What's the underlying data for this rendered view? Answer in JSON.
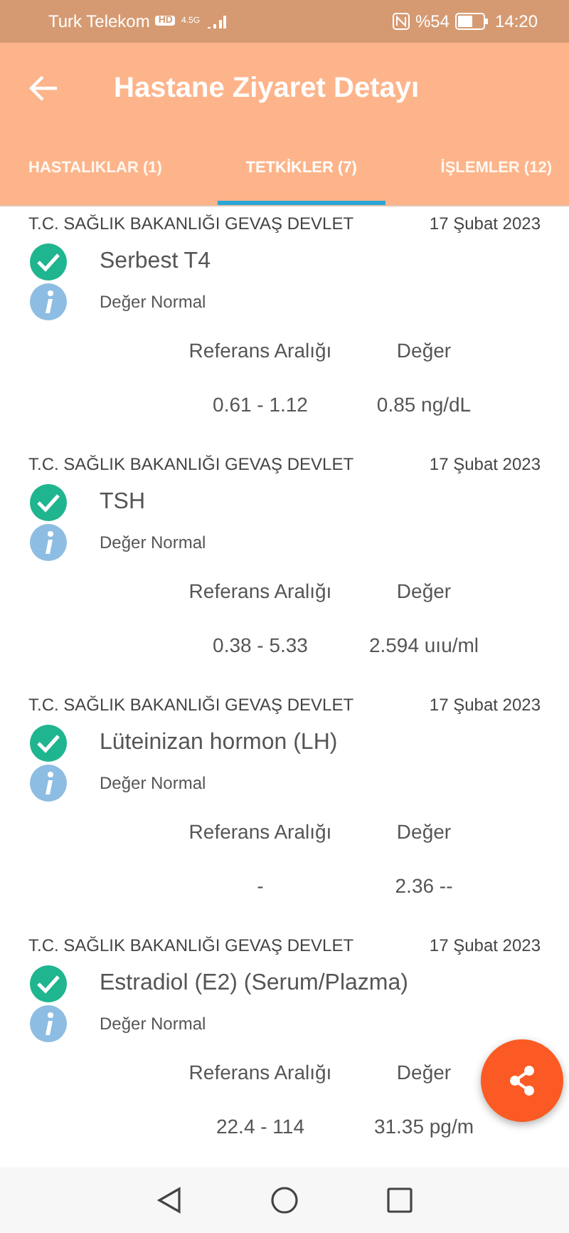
{
  "status_bar": {
    "carrier": "Turk Telekom",
    "hd": "HD",
    "network": "4.5G",
    "battery": "%54",
    "time": "14:20"
  },
  "header": {
    "title": "Hastane Ziyaret Detayı"
  },
  "tabs": [
    {
      "label": "HASTALIKLAR (1)",
      "selected": false
    },
    {
      "label": "TETKİKLER (7)",
      "selected": true
    },
    {
      "label": "İŞLEMLER (12)",
      "selected": false
    }
  ],
  "tests": [
    {
      "institution": "T.C. SAĞLIK BAKANLIĞI GEVAŞ DEVLET",
      "date": "17 Şubat 2023",
      "name": "Serbest T4",
      "normal": true,
      "status": "Değer Normal",
      "range_label": "Referans Aralığı",
      "value_label": "Değer",
      "range": "0.61 - 1.12",
      "value": "0.85 ng/dL"
    },
    {
      "institution": "T.C. SAĞLIK BAKANLIĞI GEVAŞ DEVLET",
      "date": "17 Şubat 2023",
      "name": "TSH",
      "normal": true,
      "status": "Değer Normal",
      "range_label": "Referans Aralığı",
      "value_label": "Değer",
      "range": "0.38 - 5.33",
      "value": "2.594 uıu/ml"
    },
    {
      "institution": "T.C. SAĞLIK BAKANLIĞI GEVAŞ DEVLET",
      "date": "17 Şubat 2023",
      "name": "Lüteinizan hormon (LH)",
      "normal": true,
      "status": "Değer Normal",
      "range_label": "Referans Aralığı",
      "value_label": "Değer",
      "range": "-",
      "value": "2.36 --"
    },
    {
      "institution": "T.C. SAĞLIK BAKANLIĞI GEVAŞ DEVLET",
      "date": "17 Şubat 2023",
      "name": "Estradiol (E2) (Serum/Plazma)",
      "normal": true,
      "status": "Değer Normal",
      "range_label": "Referans Aralığı",
      "value_label": "Değer",
      "range": "22.4 - 114",
      "value": "31.35 pg/m"
    }
  ]
}
